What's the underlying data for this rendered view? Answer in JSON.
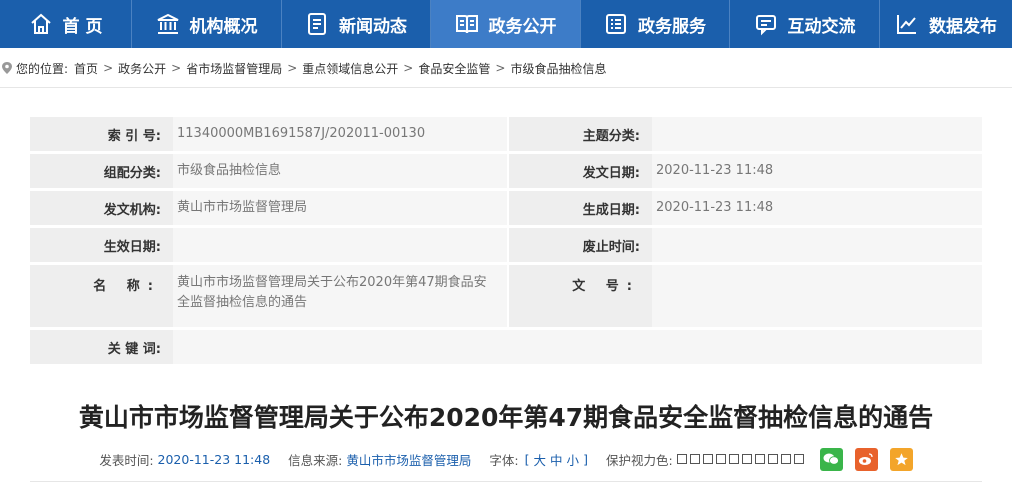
{
  "nav": {
    "items": [
      {
        "label": "首 页",
        "icon": "home-icon"
      },
      {
        "label": "机构概况",
        "icon": "building-icon"
      },
      {
        "label": "新闻动态",
        "icon": "news-icon"
      },
      {
        "label": "政务公开",
        "icon": "book-icon"
      },
      {
        "label": "政务服务",
        "icon": "list-icon"
      },
      {
        "label": "互动交流",
        "icon": "chat-icon"
      },
      {
        "label": "数据发布",
        "icon": "chart-icon"
      }
    ],
    "active_index": 3
  },
  "breadcrumb": {
    "prefix": "您的位置:",
    "items": [
      "首页",
      "政务公开",
      "省市场监督管理局",
      "重点领域信息公开",
      "食品安全监管",
      "市级食品抽检信息"
    ]
  },
  "meta": {
    "index_label": "索 引 号:",
    "index_value": "11340000MB1691587J/202011-00130",
    "topic_label": "主题分类:",
    "topic_value": "",
    "category_label": "组配分类:",
    "category_value": "市级食品抽检信息",
    "pubdate_label": "发文日期:",
    "pubdate_value": "2020-11-23 11:48",
    "org_label": "发文机构:",
    "org_value": "黄山市市场监督管理局",
    "gendate_label": "生成日期:",
    "gendate_value": "2020-11-23 11:48",
    "effective_label": "生效日期:",
    "effective_value": "",
    "expire_label": "废止时间:",
    "expire_value": "",
    "name_label": "名 称:",
    "name_value": "黄山市市场监督管理局关于公布2020年第47期食品安全监督抽检信息的通告",
    "docno_label": "文 号:",
    "docno_value": "",
    "keywords_label": "关 键 词:",
    "keywords_value": ""
  },
  "article": {
    "title": "黄山市市场监督管理局关于公布2020年第47期食品安全监督抽检信息的通告",
    "publish_time_label": "发表时间:",
    "publish_time": "2020-11-23 11:48",
    "source_label": "信息来源:",
    "source": "黄山市市场监督管理局",
    "font_label": "字体:",
    "font_open": "[",
    "font_large": "大",
    "font_medium": "中",
    "font_small": "小",
    "font_close": "]",
    "color_label": "保护视力色:"
  },
  "share": {
    "wechat_color": "#3ab54a",
    "weibo_color": "#e8622c",
    "favorite_color": "#f3a52a"
  },
  "colors": {
    "nav_bg": "#1b5fac",
    "nav_active": "#3d7cc8",
    "link_blue": "#1b5fac"
  }
}
